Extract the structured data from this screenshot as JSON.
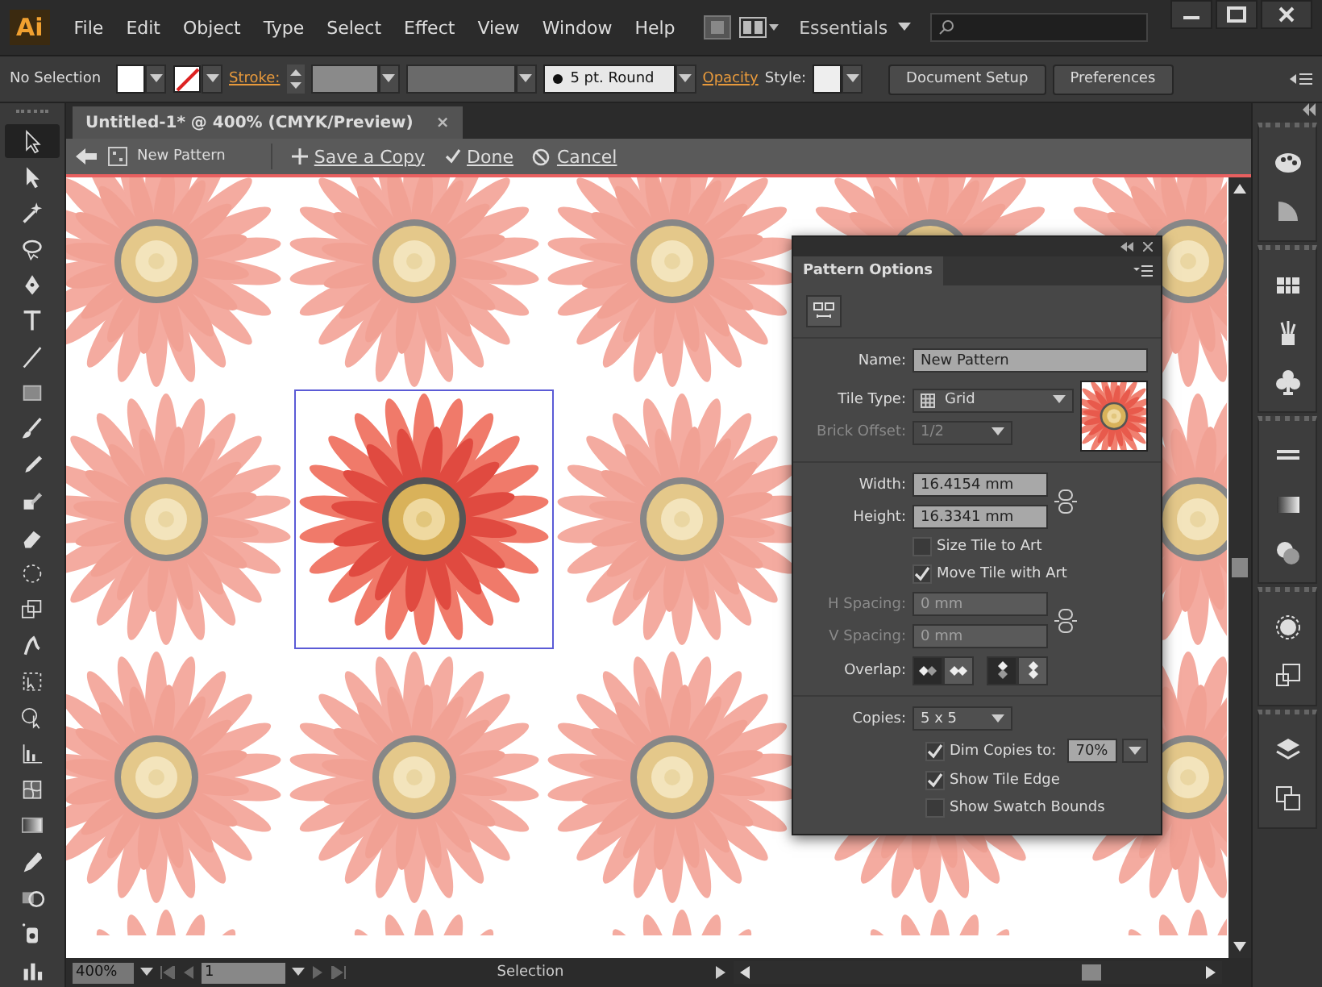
{
  "menubar": {
    "logo": "Ai",
    "menus": [
      "File",
      "Edit",
      "Object",
      "Type",
      "Select",
      "Effect",
      "View",
      "Window",
      "Help"
    ],
    "workspace": "Essentials"
  },
  "control_bar": {
    "selection": "No Selection",
    "stroke_label": "Stroke:",
    "brush": "5 pt. Round",
    "opacity_label": "Opacity",
    "style_label": "Style:",
    "buttons": [
      "Document Setup",
      "Preferences"
    ]
  },
  "tools": [
    {
      "selected": true
    },
    {
      "selected": false
    },
    {
      "selected": false
    },
    {
      "selected": false
    },
    {
      "selected": false
    },
    {
      "selected": false
    },
    {
      "selected": false
    },
    {
      "selected": false
    },
    {
      "selected": false
    },
    {
      "selected": false
    },
    {
      "selected": false
    },
    {
      "selected": false
    },
    {
      "selected": false
    },
    {
      "selected": false
    },
    {
      "selected": false
    },
    {
      "selected": false
    },
    {
      "selected": false
    },
    {
      "selected": false
    },
    {
      "selected": false
    },
    {
      "selected": false
    },
    {
      "selected": false
    },
    {
      "selected": false
    },
    {
      "selected": false
    },
    {
      "selected": false
    }
  ],
  "document": {
    "tab_title": "Untitled-1* @ 400% (CMYK/Preview)",
    "close": "×"
  },
  "pattern_bar": {
    "pattern_name": "New Pattern",
    "actions": [
      {
        "kind": "save",
        "label": "Save a Copy"
      },
      {
        "kind": "done",
        "label": "Done"
      },
      {
        "kind": "cancel",
        "label": "Cancel"
      }
    ]
  },
  "pattern_options": {
    "title": "Pattern Options",
    "name": {
      "label": "Name:",
      "value": "New Pattern"
    },
    "tile_type": {
      "label": "Tile Type:",
      "value": "Grid"
    },
    "brick_offset": {
      "label": "Brick Offset:",
      "value": "1/2",
      "disabled": true
    },
    "width": {
      "label": "Width:",
      "value": "16.4154 mm"
    },
    "height": {
      "label": "Height:",
      "value": "16.3341 mm"
    },
    "size_tile_to_art": {
      "label": "Size Tile to Art",
      "checked": false
    },
    "move_tile_with_art": {
      "label": "Move Tile with Art",
      "checked": true
    },
    "h_spacing": {
      "label": "H Spacing:",
      "value": "0 mm",
      "disabled": true
    },
    "v_spacing": {
      "label": "V Spacing:",
      "value": "0 mm",
      "disabled": true
    },
    "overlap": {
      "label": "Overlap:",
      "horizontal": [
        {
          "selected": true
        },
        {
          "selected": false
        }
      ],
      "vertical": [
        {
          "selected": true
        },
        {
          "selected": false
        }
      ]
    },
    "copies": {
      "label": "Copies:",
      "value": "5 x 5"
    },
    "dim_copies": {
      "label": "Dim Copies to:",
      "checked": true,
      "value": "70%"
    },
    "show_tile_edge": {
      "label": "Show Tile Edge",
      "checked": true
    },
    "show_swatch_bounds": {
      "label": "Show Swatch Bounds",
      "checked": false
    }
  },
  "status_bar": {
    "zoom": "400%",
    "page": "1",
    "tool": "Selection"
  }
}
